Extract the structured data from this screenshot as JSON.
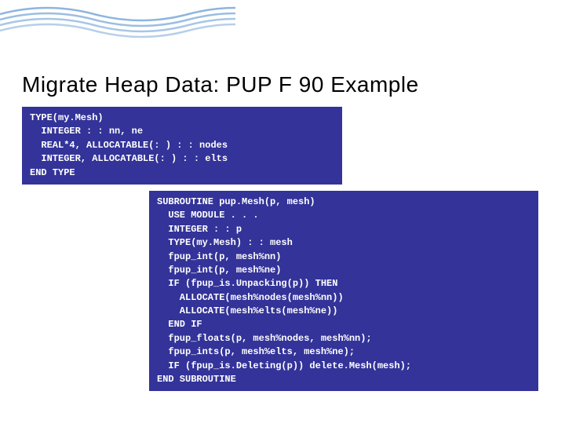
{
  "title": "Migrate Heap Data: PUP F 90 Example",
  "code1": "TYPE(my.Mesh)\n  INTEGER : : nn, ne\n  REAL*4, ALLOCATABLE(: ) : : nodes\n  INTEGER, ALLOCATABLE(: ) : : elts\nEND TYPE",
  "code2": "SUBROUTINE pup.Mesh(p, mesh)\n  USE MODULE . . .\n  INTEGER : : p\n  TYPE(my.Mesh) : : mesh\n  fpup_int(p, mesh%nn)\n  fpup_int(p, mesh%ne)\n  IF (fpup_is.Unpacking(p)) THEN\n    ALLOCATE(mesh%nodes(mesh%nn))\n    ALLOCATE(mesh%elts(mesh%ne))\n  END IF\n  fpup_floats(p, mesh%nodes, mesh%nn);\n  fpup_ints(p, mesh%elts, mesh%ne);\n  IF (fpup_is.Deleting(p)) delete.Mesh(mesh);\nEND SUBROUTINE"
}
